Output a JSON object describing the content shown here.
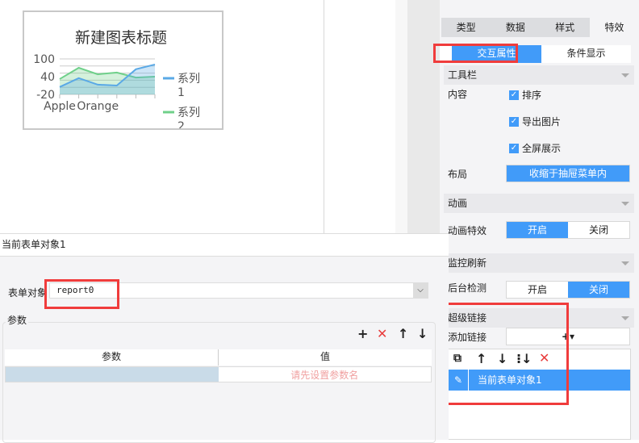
{
  "chart_data": {
    "type": "area",
    "title": "新建图表标题",
    "categories": [
      "Apple",
      "",
      "Orange",
      "",
      "",
      ""
    ],
    "ylim": [
      -20,
      100
    ],
    "yticks": [
      "100",
      "40",
      "-20"
    ],
    "series": [
      {
        "name": "系列1",
        "color": "#5aa9e6",
        "values": [
          5,
          35,
          13,
          10,
          65,
          81
        ]
      },
      {
        "name": "系列2",
        "color": "#6fd08a",
        "values": [
          32,
          70,
          48,
          54,
          37,
          40
        ]
      }
    ],
    "legend": "right"
  },
  "right": {
    "tabs": [
      "类型",
      "数据",
      "样式",
      "特效"
    ],
    "subtabs": [
      "交互属性",
      "条件显示"
    ],
    "toolbar": {
      "title": "工具栏",
      "content_label": "内容",
      "items": [
        "排序",
        "导出图片",
        "全屏展示"
      ],
      "layout_label": "布局",
      "layout_value": "收缩于抽屉菜单内"
    },
    "animation": {
      "title": "动画",
      "label": "动画特效",
      "on": "开启",
      "off": "关闭"
    },
    "monitor": {
      "title": "监控刷新",
      "label": "后台检测",
      "on": "开启",
      "off": "关闭"
    },
    "hyperlink": {
      "title": "超级链接",
      "add_label": "添加链接",
      "add_icon": "+▾",
      "item": "当前表单对象1"
    }
  },
  "dialog": {
    "title": "当前表单对象1",
    "form_label": "表单对象",
    "form_value": "report0",
    "params_label": "参数",
    "columns": [
      "参数",
      "值"
    ],
    "placeholder": "请先设置参数名"
  }
}
